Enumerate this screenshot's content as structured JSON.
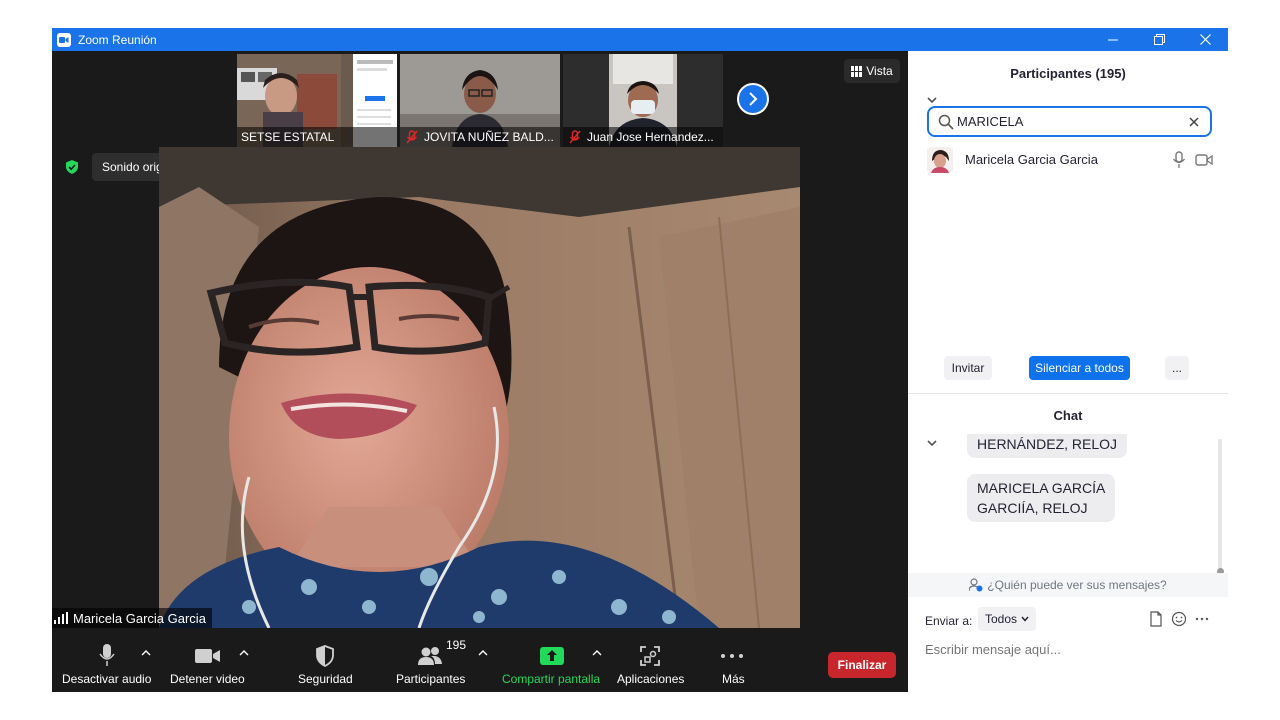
{
  "window": {
    "title": "Zoom Reunión"
  },
  "video": {
    "view_button": "Vista",
    "sound_status": "Sonido original: desactivado",
    "active_speaker": "Maricela Garcia Garcia",
    "thumbnails": [
      {
        "name": "SETSE ESTATAL",
        "muted": false
      },
      {
        "name": "JOVITA NUÑEZ BALD...",
        "muted": true
      },
      {
        "name": "Juan Jose Hernandez...",
        "muted": true
      }
    ]
  },
  "toolbar": {
    "mute": "Desactivar audio",
    "stop_video": "Detener video",
    "security": "Seguridad",
    "participants": "Participantes",
    "participants_count": "195",
    "share": "Compartir pantalla",
    "apps": "Aplicaciones",
    "more": "Más",
    "end": "Finalizar"
  },
  "participants_panel": {
    "title": "Participantes (195)",
    "search_value": "MARICELA",
    "results": [
      {
        "name": "Maricela Garcia Garcia"
      }
    ],
    "invite": "Invitar",
    "mute_all": "Silenciar a todos",
    "more": "..."
  },
  "chat": {
    "title": "Chat",
    "messages": [
      {
        "line1": "HERNÁNDEZ, RELOJ",
        "line2": ""
      },
      {
        "line1": "MARICELA GARCÍA",
        "line2": "GARCIÍA, RELOJ"
      }
    ],
    "who_can_see": "¿Quién puede ver sus mensajes?",
    "send_to_label": "Enviar a:",
    "send_to_value": "Todos",
    "input_placeholder": "Escribir mensaje aquí..."
  },
  "colors": {
    "zoom_blue": "#1a73e8",
    "end_red": "#c8262d",
    "share_green": "#23d959"
  }
}
